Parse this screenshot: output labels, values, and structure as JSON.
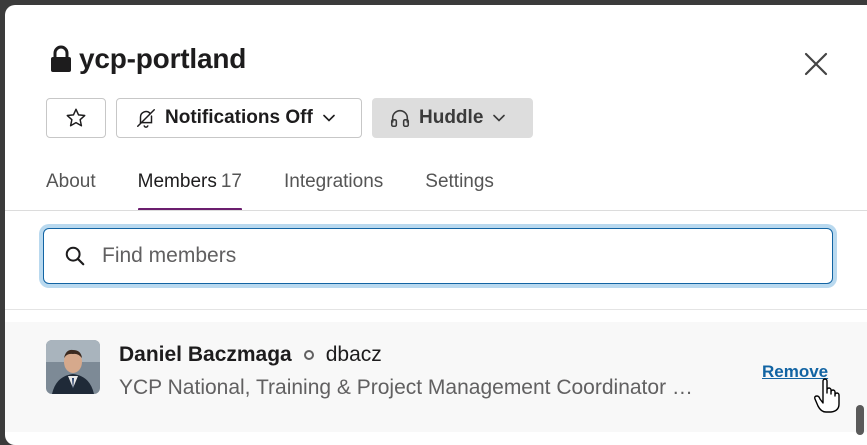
{
  "channel": {
    "name": "ycp-portland",
    "lock_icon": "lock-icon"
  },
  "actions": {
    "star_icon": "star-icon",
    "notifications_label": "Notifications Off",
    "notifications_icon": "bell-off-icon",
    "huddle_label": "Huddle",
    "huddle_icon": "headphones-icon"
  },
  "tabs": [
    {
      "label": "About"
    },
    {
      "label": "Members",
      "count": "17",
      "active": true
    },
    {
      "label": "Integrations"
    },
    {
      "label": "Settings"
    }
  ],
  "search": {
    "placeholder": "Find members",
    "value": ""
  },
  "members": [
    {
      "name": "Daniel Baczmaga",
      "handle": "dbacz",
      "title": "YCP National, Training & Project Management Coordinator …",
      "action_label": "Remove"
    }
  ],
  "colors": {
    "accent_tab": "#6b1e6e",
    "link": "#1264a3",
    "focus_ring": "#b9d9ef"
  }
}
